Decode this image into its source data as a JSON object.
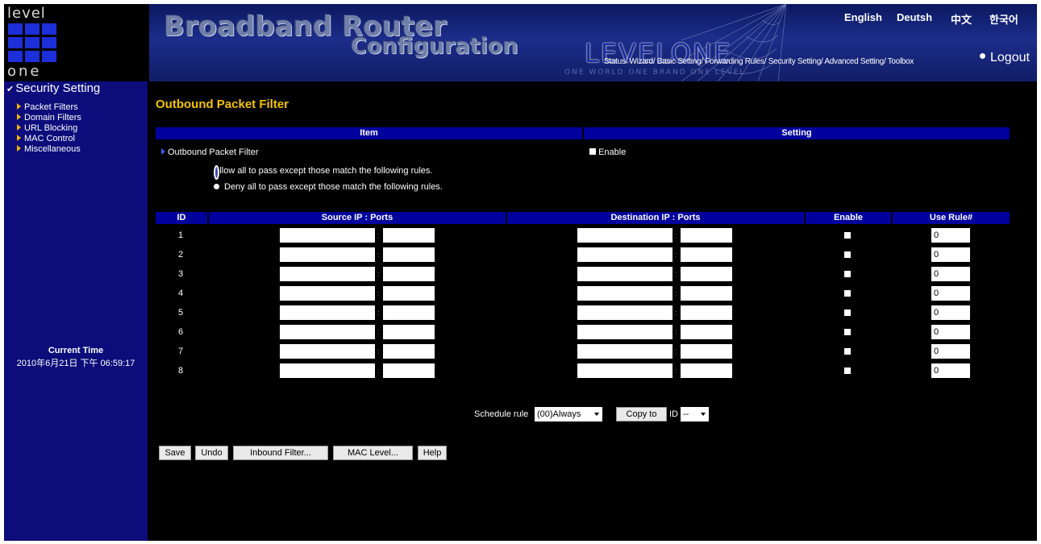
{
  "header": {
    "logo_top": "level",
    "logo_bottom": "one",
    "title_line1": "Broadband Router",
    "title_line2": "Configuration",
    "brand": "LEVELONE",
    "slogan": "ONE WORLD  ONE BRAND  ONE LEVEL",
    "languages": [
      "English",
      "Deutsh",
      "中文",
      "한국어"
    ],
    "menu": "Status/ Wizard/ Basic Setting/ Forwarding Rules/ Security Setting/ Advanced Setting/ Toolbox",
    "logout": "Logout"
  },
  "sidebar": {
    "section": "Security Setting",
    "items": [
      "Packet Filters",
      "Domain Filters",
      "URL Blocking",
      "MAC Control",
      "Miscellaneous"
    ],
    "current_time_label": "Current Time",
    "current_time_value": "2010年6月21日 下午 06:59:17"
  },
  "main": {
    "page_title": "Outbound Packet Filter",
    "col_item": "Item",
    "col_setting": "Setting",
    "filter_label": "Outbound Packet Filter",
    "enable_label": "Enable",
    "radio_allow": "Allow all to pass except those match the following rules.",
    "radio_deny": "Deny all to pass except those match the following rules.",
    "table_headers": [
      "ID",
      "Source IP : Ports",
      "Destination IP : Ports",
      "Enable",
      "Use Rule#"
    ],
    "rows": [
      {
        "id": "1",
        "rule": "0"
      },
      {
        "id": "2",
        "rule": "0"
      },
      {
        "id": "3",
        "rule": "0"
      },
      {
        "id": "4",
        "rule": "0"
      },
      {
        "id": "5",
        "rule": "0"
      },
      {
        "id": "6",
        "rule": "0"
      },
      {
        "id": "7",
        "rule": "0"
      },
      {
        "id": "8",
        "rule": "0"
      }
    ],
    "separator": ":",
    "schedule_label": "Schedule rule",
    "schedule_value": "(00)Always",
    "copy_button": "Copy to",
    "id_label": "ID",
    "id_value": "--",
    "buttons": {
      "save": "Save",
      "undo": "Undo",
      "inbound": "Inbound Filter...",
      "mac": "MAC Level...",
      "help": "Help"
    }
  }
}
